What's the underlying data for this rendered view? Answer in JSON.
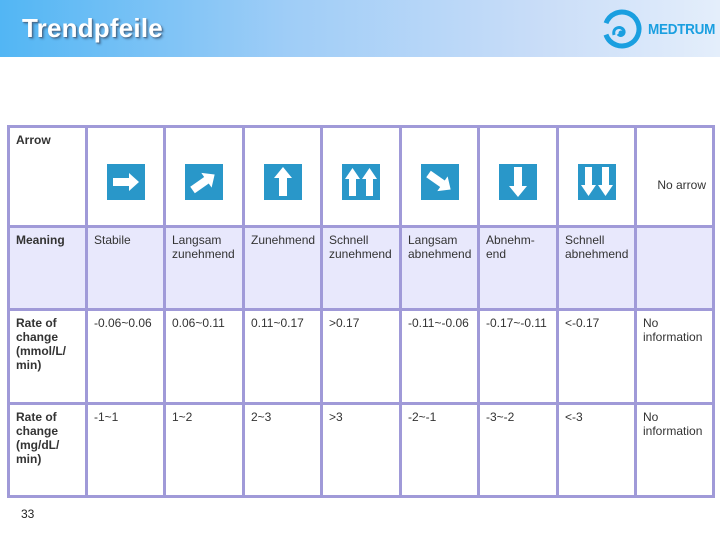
{
  "header": {
    "title": "Trendpfeile",
    "logo_text": "MEDTRUM",
    "logo_icon": "medtrum-swirl-icon"
  },
  "colors": {
    "arrow_box": "#2997c9",
    "table_border": "#a09ad8",
    "meaning_row_bg": "#e8e8fc",
    "logo": "#1a9fe0"
  },
  "table": {
    "row_labels": {
      "arrow": "Arrow",
      "meaning": "Meaning",
      "rate_mmol": "Rate of change (mmol/L/ min)",
      "rate_mg": "Rate of change (mg/dL/ min)"
    },
    "columns": [
      {
        "icon": "arrow-right-icon",
        "meaning": "Stabile",
        "rate_mmol": "-0.06~0.06",
        "rate_mg": "-1~1"
      },
      {
        "icon": "arrow-up-right-icon",
        "meaning": "Langsam zunehmend",
        "rate_mmol": "0.06~0.11",
        "rate_mg": "1~2"
      },
      {
        "icon": "arrow-up-icon",
        "meaning": "Zunehmend",
        "rate_mmol": "0.11~0.17",
        "rate_mg": "2~3"
      },
      {
        "icon": "double-arrow-up-icon",
        "meaning": "Schnell zunehmend",
        "rate_mmol": ">0.17",
        "rate_mg": ">3"
      },
      {
        "icon": "arrow-down-right-icon",
        "meaning": "Langsam abnehmend",
        "rate_mmol": "-0.11~-0.06",
        "rate_mg": "-2~-1"
      },
      {
        "icon": "arrow-down-icon",
        "meaning": "Abnehm-end",
        "rate_mmol": "-0.17~-0.11",
        "rate_mg": "-3~-2"
      },
      {
        "icon": "double-arrow-down-icon",
        "meaning": "Schnell abnehmend",
        "rate_mmol": "<-0.17",
        "rate_mg": "<-3"
      },
      {
        "icon": null,
        "arrow_text": "No arrow",
        "meaning": "",
        "rate_mmol": "No information",
        "rate_mg": "No information"
      }
    ]
  },
  "footer": {
    "page_number": "33"
  }
}
